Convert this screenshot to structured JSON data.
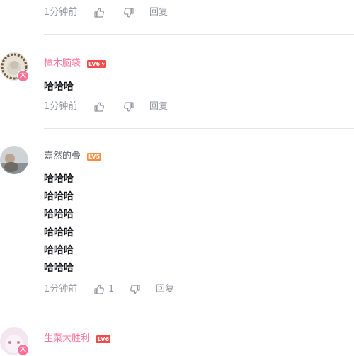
{
  "comments": [
    {
      "time": "1分钟前",
      "reply_label": "回复"
    },
    {
      "username": "樟木脑袋",
      "level": "LV6",
      "avatar_badge": "大",
      "lines": [
        "哈哈哈"
      ],
      "time": "1分钟前",
      "reply_label": "回复"
    },
    {
      "username": "嘉然的叠",
      "level": "LV5",
      "lines": [
        "哈哈哈",
        "哈哈哈",
        "哈哈哈",
        "哈哈哈",
        "哈哈哈",
        "哈哈哈"
      ],
      "time": "1分钟前",
      "like_count": "1",
      "reply_label": "回复"
    },
    {
      "username": "生菜大胜利",
      "level": "LV6",
      "avatar_badge": "大"
    }
  ],
  "colors": {
    "vip_name": "#fb7299",
    "normal_name": "#61666d",
    "meta_text": "#9499a0",
    "level5": "#ff8b3d",
    "level6": "#f04c49",
    "divider": "#e3e5e7"
  }
}
